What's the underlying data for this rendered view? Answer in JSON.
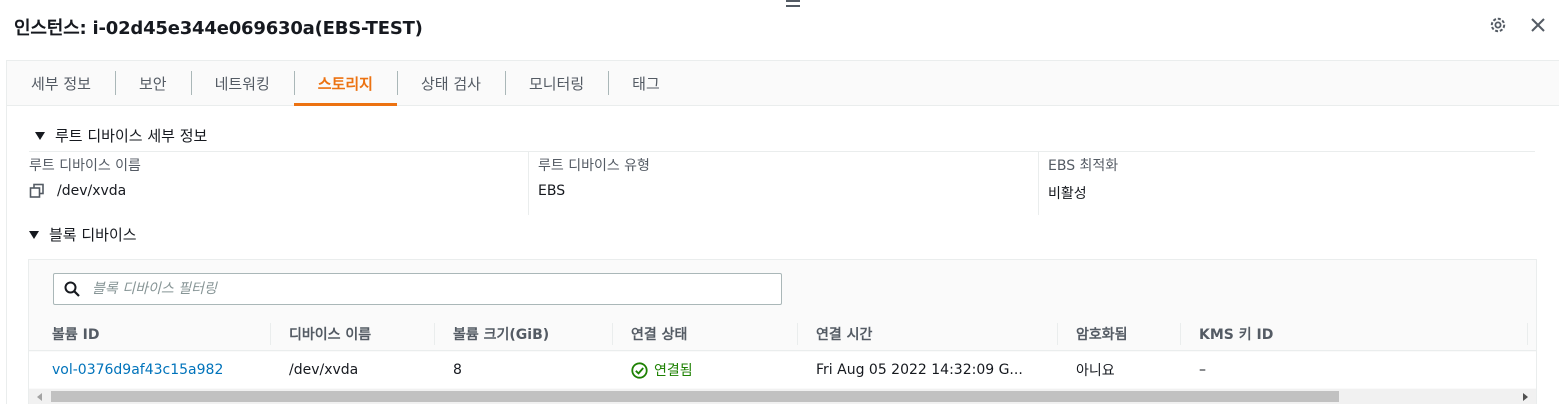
{
  "panel": {
    "title": "인스턴스: i-02d45e344e069630a(EBS-TEST)",
    "settings_icon": "gear-icon",
    "close_icon": "close-icon"
  },
  "tabs": [
    {
      "label": "세부 정보",
      "active": false
    },
    {
      "label": "보안",
      "active": false
    },
    {
      "label": "네트워킹",
      "active": false
    },
    {
      "label": "스토리지",
      "active": true
    },
    {
      "label": "상태 검사",
      "active": false
    },
    {
      "label": "모니터링",
      "active": false
    },
    {
      "label": "태그",
      "active": false
    }
  ],
  "root_device": {
    "section_title": "루트 디바이스 세부 정보",
    "name_label": "루트 디바이스 이름",
    "name_value": "/dev/xvda",
    "type_label": "루트 디바이스 유형",
    "type_value": "EBS",
    "ebs_opt_label": "EBS 최적화",
    "ebs_opt_value": "비활성"
  },
  "block_devices": {
    "section_title": "블록 디바이스",
    "filter_placeholder": "블록 디바이스 필터링",
    "columns": [
      "볼륨 ID",
      "디바이스 이름",
      "볼륨 크기(GiB)",
      "연결 상태",
      "연결 시간",
      "암호화됨",
      "KMS 키 ID"
    ],
    "rows": [
      {
        "volume_id": "vol-0376d9af43c15a982",
        "device_name": "/dev/xvda",
        "size": "8",
        "attach_status": "연결됨",
        "attach_time": "Fri Aug 05 2022 14:32:09 G...",
        "encrypted": "아니요",
        "kms_key_id": "–"
      }
    ]
  },
  "colors": {
    "accent": "#ec7211",
    "link": "#0073bb",
    "success": "#1d8102"
  }
}
